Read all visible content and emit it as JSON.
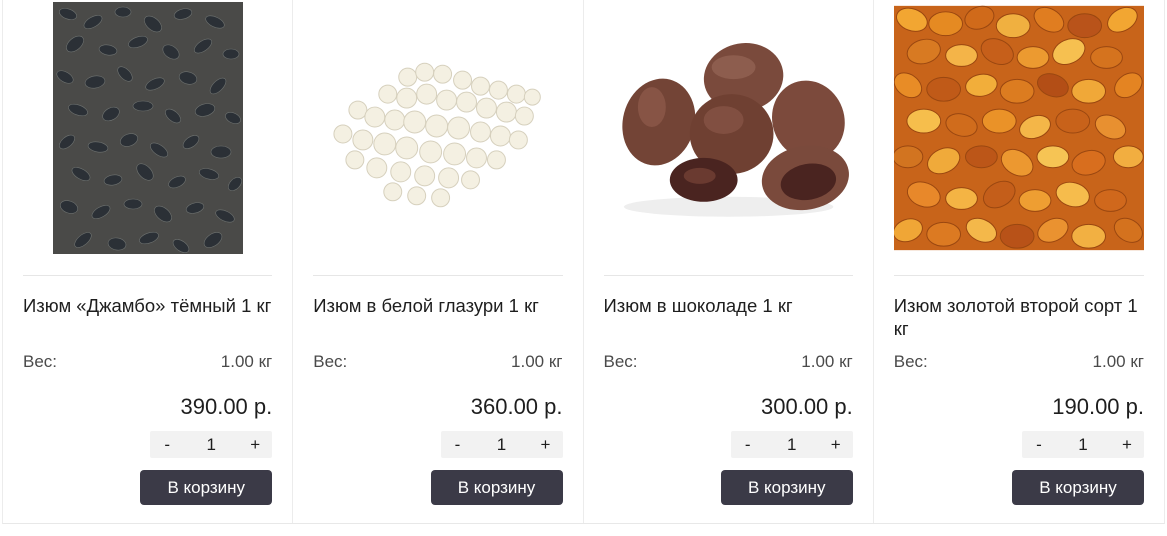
{
  "products": [
    {
      "title": "Изюм «Джамбо» тёмный 1 кг",
      "weight_label": "Вес:",
      "weight_value": "1.00 кг",
      "price": "390.00 р.",
      "qty_minus": "-",
      "qty": "1",
      "qty_plus": "+",
      "cart_label": "В корзину",
      "image": "dark-raisins-image"
    },
    {
      "title": "Изюм в белой глазури 1 кг",
      "weight_label": "Вес:",
      "weight_value": "1.00 кг",
      "price": "360.00 р.",
      "qty_minus": "-",
      "qty": "1",
      "qty_plus": "+",
      "cart_label": "В корзину",
      "image": "white-glazed-raisins-image"
    },
    {
      "title": "Изюм в шоколаде 1 кг",
      "weight_label": "Вес:",
      "weight_value": "1.00 кг",
      "price": "300.00 р.",
      "qty_minus": "-",
      "qty": "1",
      "qty_plus": "+",
      "cart_label": "В корзину",
      "image": "chocolate-raisins-image"
    },
    {
      "title": "Изюм золотой второй сорт 1 кг",
      "weight_label": "Вес:",
      "weight_value": "1.00 кг",
      "price": "190.00 р.",
      "qty_minus": "-",
      "qty": "1",
      "qty_plus": "+",
      "cart_label": "В корзину",
      "image": "golden-raisins-image"
    }
  ],
  "colors": {
    "button_bg": "#3b3a47",
    "button_text": "#ffffff",
    "stepper_bg": "#f2f2f2",
    "divider": "#e6e6e6"
  }
}
